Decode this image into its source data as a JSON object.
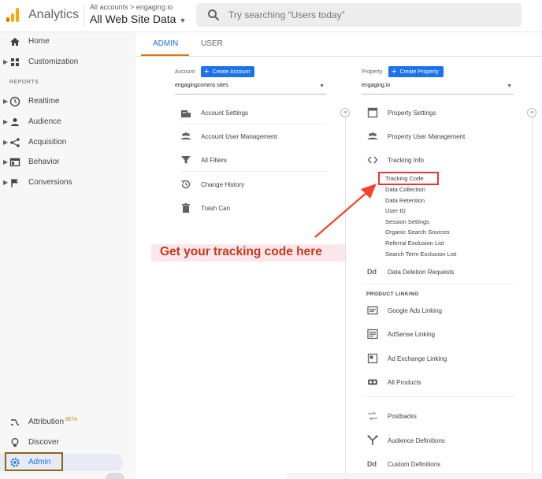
{
  "header": {
    "brand": "Analytics",
    "breadcrumb": "All accounts > engaging.io",
    "property_title": "All Web Site Data",
    "search_placeholder": "Try searching “Users today”"
  },
  "sidebar": {
    "items": [
      {
        "label": "Home",
        "icon": "home-icon"
      },
      {
        "label": "Customization",
        "icon": "dashboard-icon"
      }
    ],
    "section_label": "REPORTS",
    "reports": [
      {
        "label": "Realtime",
        "icon": "clock-icon"
      },
      {
        "label": "Audience",
        "icon": "person-icon"
      },
      {
        "label": "Acquisition",
        "icon": "acquisition-icon"
      },
      {
        "label": "Behavior",
        "icon": "behavior-icon"
      },
      {
        "label": "Conversions",
        "icon": "flag-icon"
      }
    ],
    "bottom": [
      {
        "label": "Attribution",
        "badge": "BETA",
        "icon": "attribution-icon"
      },
      {
        "label": "Discover",
        "icon": "lightbulb-icon"
      },
      {
        "label": "Admin",
        "icon": "gear-icon"
      }
    ]
  },
  "tabs": [
    {
      "label": "ADMIN",
      "active": true
    },
    {
      "label": "USER",
      "active": false
    }
  ],
  "account": {
    "label": "Account",
    "create_button": "Create Account",
    "selected": "engagingcomms sites",
    "rows": [
      {
        "label": "Account Settings",
        "icon": "building-icon"
      },
      {
        "label": "Account User Management",
        "icon": "people-icon"
      },
      {
        "label": "All Filters",
        "icon": "filter-icon"
      },
      {
        "label": "Change History",
        "icon": "history-icon"
      },
      {
        "label": "Trash Can",
        "icon": "trash-icon"
      }
    ]
  },
  "property": {
    "label": "Property",
    "create_button": "Create Property",
    "selected": "engaging.io",
    "rows": [
      {
        "label": "Property Settings",
        "icon": "property-icon"
      },
      {
        "label": "Property User Management",
        "icon": "people-icon"
      },
      {
        "label": "Tracking Info",
        "icon": "code-icon"
      }
    ],
    "tracking_sub_items": [
      "Tracking Code",
      "Data Collection",
      "Data Retention",
      "User-ID",
      "Session Settings",
      "Organic Search Sources",
      "Referral Exclusion List",
      "Search Term Exclusion List"
    ],
    "data_deletion": {
      "label": "Data Deletion Requests",
      "icon_text": "Dd"
    },
    "product_linking_label": "PRODUCT LINKING",
    "linking_rows": [
      {
        "label": "Google Ads Linking",
        "icon": "ads-icon"
      },
      {
        "label": "AdSense Linking",
        "icon": "adsense-icon"
      },
      {
        "label": "Ad Exchange Linking",
        "icon": "adexchange-icon"
      },
      {
        "label": "All Products",
        "icon": "products-icon"
      }
    ],
    "other_rows": [
      {
        "label": "Postbacks",
        "icon": "postbacks-icon"
      },
      {
        "label": "Audience Definitions",
        "icon": "audience-def-icon"
      },
      {
        "label": "Custom Definitions",
        "icon_text": "Dd"
      }
    ]
  },
  "annotation": {
    "callout_text": "Get your tracking code here",
    "highlight_color": "#e53935",
    "text_color": "#c0391b"
  },
  "colors": {
    "accent": "#1a73e8",
    "tab_underline": "#e8710a"
  }
}
